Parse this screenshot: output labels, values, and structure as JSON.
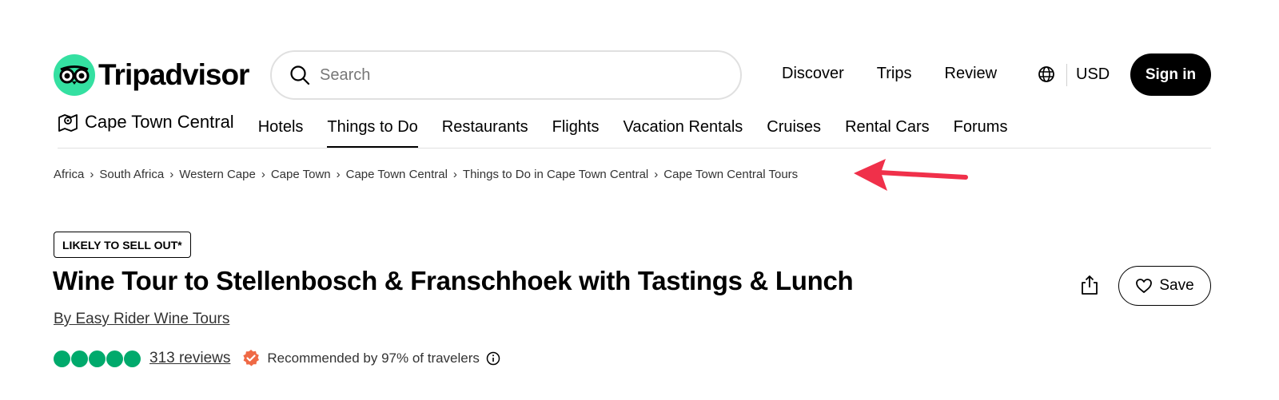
{
  "brand": {
    "name": "Tripadvisor",
    "logo_color": "#34e0a1"
  },
  "search": {
    "placeholder": "Search"
  },
  "topnav": {
    "discover": "Discover",
    "trips": "Trips",
    "review": "Review",
    "currency": "USD",
    "signin": "Sign in"
  },
  "secondnav": {
    "location": "Cape Town Central",
    "tabs": [
      "Hotels",
      "Things to Do",
      "Restaurants",
      "Flights",
      "Vacation Rentals",
      "Cruises",
      "Rental Cars",
      "Forums"
    ],
    "active": "Things to Do"
  },
  "breadcrumb": [
    "Africa",
    "South Africa",
    "Western Cape",
    "Cape Town",
    "Cape Town Central",
    "Things to Do in Cape Town Central",
    "Cape Town Central Tours"
  ],
  "listing": {
    "badge": "LIKELY TO SELL OUT*",
    "title": "Wine Tour to Stellenbosch & Franschhoek with Tastings & Lunch",
    "byline": "By Easy Rider Wine Tours",
    "save_label": "Save",
    "rating_bubbles": 5,
    "reviews": "313 reviews",
    "recommended": "Recommended by 97% of travelers"
  },
  "colors": {
    "rating": "#00aa6c",
    "annotation_arrow": "#f0304a",
    "recommend_badge": "#ef6945"
  }
}
